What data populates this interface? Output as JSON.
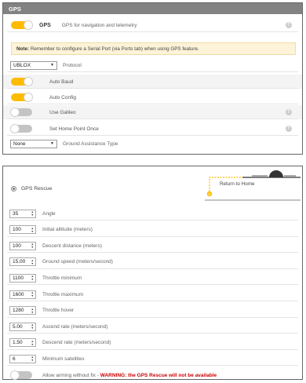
{
  "gps": {
    "header": "GPS",
    "enable_label": "GPS",
    "enable_desc": "GPS for navigation and telemetry",
    "note_prefix": "Note:",
    "note_text": " Remember to configure a Serial Port (via Ports tab) when using GPS feature.",
    "protocol_value": "UBLOX",
    "protocol_label": "Protocol",
    "auto_baud": "Auto Baud",
    "auto_config": "Auto Config",
    "use_galileo": "Use Galileo",
    "home_point_once": "Set Home Point Once",
    "ground_assist_value": "None",
    "ground_assist_label": "Ground Assistance Type",
    "help_glyph": "?"
  },
  "rescue": {
    "mode_label": "GPS Rescue",
    "diagram_label": "Return to Home",
    "fields": [
      {
        "value": "35",
        "label": "Angle"
      },
      {
        "value": "100",
        "label": "Initial altitude (meters)"
      },
      {
        "value": "100",
        "label": "Descent distance (meters)"
      },
      {
        "value": "15.00",
        "label": "Ground speed (meters/second)"
      },
      {
        "value": "1100",
        "label": "Throttle minimum"
      },
      {
        "value": "1600",
        "label": "Throttle maximum"
      },
      {
        "value": "1280",
        "label": "Throttle hover"
      },
      {
        "value": "5.00",
        "label": "Ascend rate (meters/second)"
      },
      {
        "value": "1.50",
        "label": "Descend rate (meters/second)"
      },
      {
        "value": "6",
        "label": "Minimum satellites"
      }
    ],
    "allow_arming_label": "Allow arming without fix - ",
    "allow_arming_warning": "WARNING: the GPS Rescue will not be available"
  },
  "colors": {
    "accent": "#ffbb00",
    "header": "#828282",
    "warning": "#cc0000"
  },
  "icons": {
    "dropdown": "chevron-down-icon",
    "spinner": "spinner-arrows-icon",
    "help": "help-icon"
  }
}
